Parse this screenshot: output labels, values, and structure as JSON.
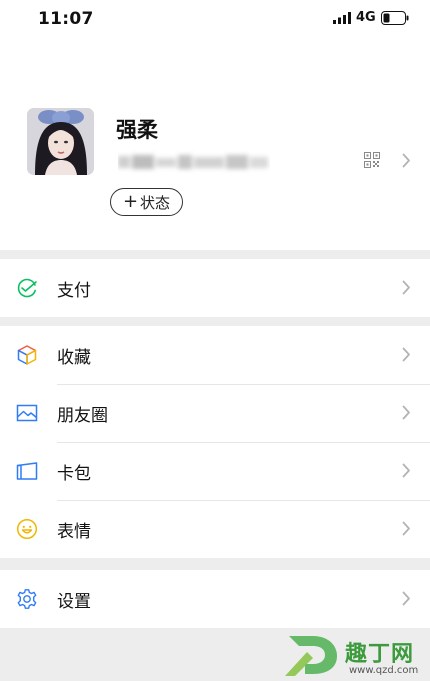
{
  "status_bar": {
    "time": "11:07",
    "network": "4G"
  },
  "profile": {
    "nickname": "强柔",
    "status_button_plus": "+",
    "status_button_label": "状态"
  },
  "menu": {
    "pay": {
      "label": "支付",
      "icon": "pay-check-icon",
      "color": "#07c160"
    },
    "favorites": {
      "label": "收藏",
      "icon": "cube-icon"
    },
    "moments": {
      "label": "朋友圈",
      "icon": "picture-icon",
      "color": "#2f7cf6"
    },
    "cards": {
      "label": "卡包",
      "icon": "wallet-card-icon",
      "color": "#2f7cf6"
    },
    "stickers": {
      "label": "表情",
      "icon": "smiley-icon",
      "color": "#f2b600"
    },
    "settings": {
      "label": "设置",
      "icon": "gear-icon",
      "color": "#2f7cf6"
    }
  },
  "watermark": {
    "title": "趣丁网",
    "url": "www.qzd.com",
    "color": "#3d9b3d"
  }
}
